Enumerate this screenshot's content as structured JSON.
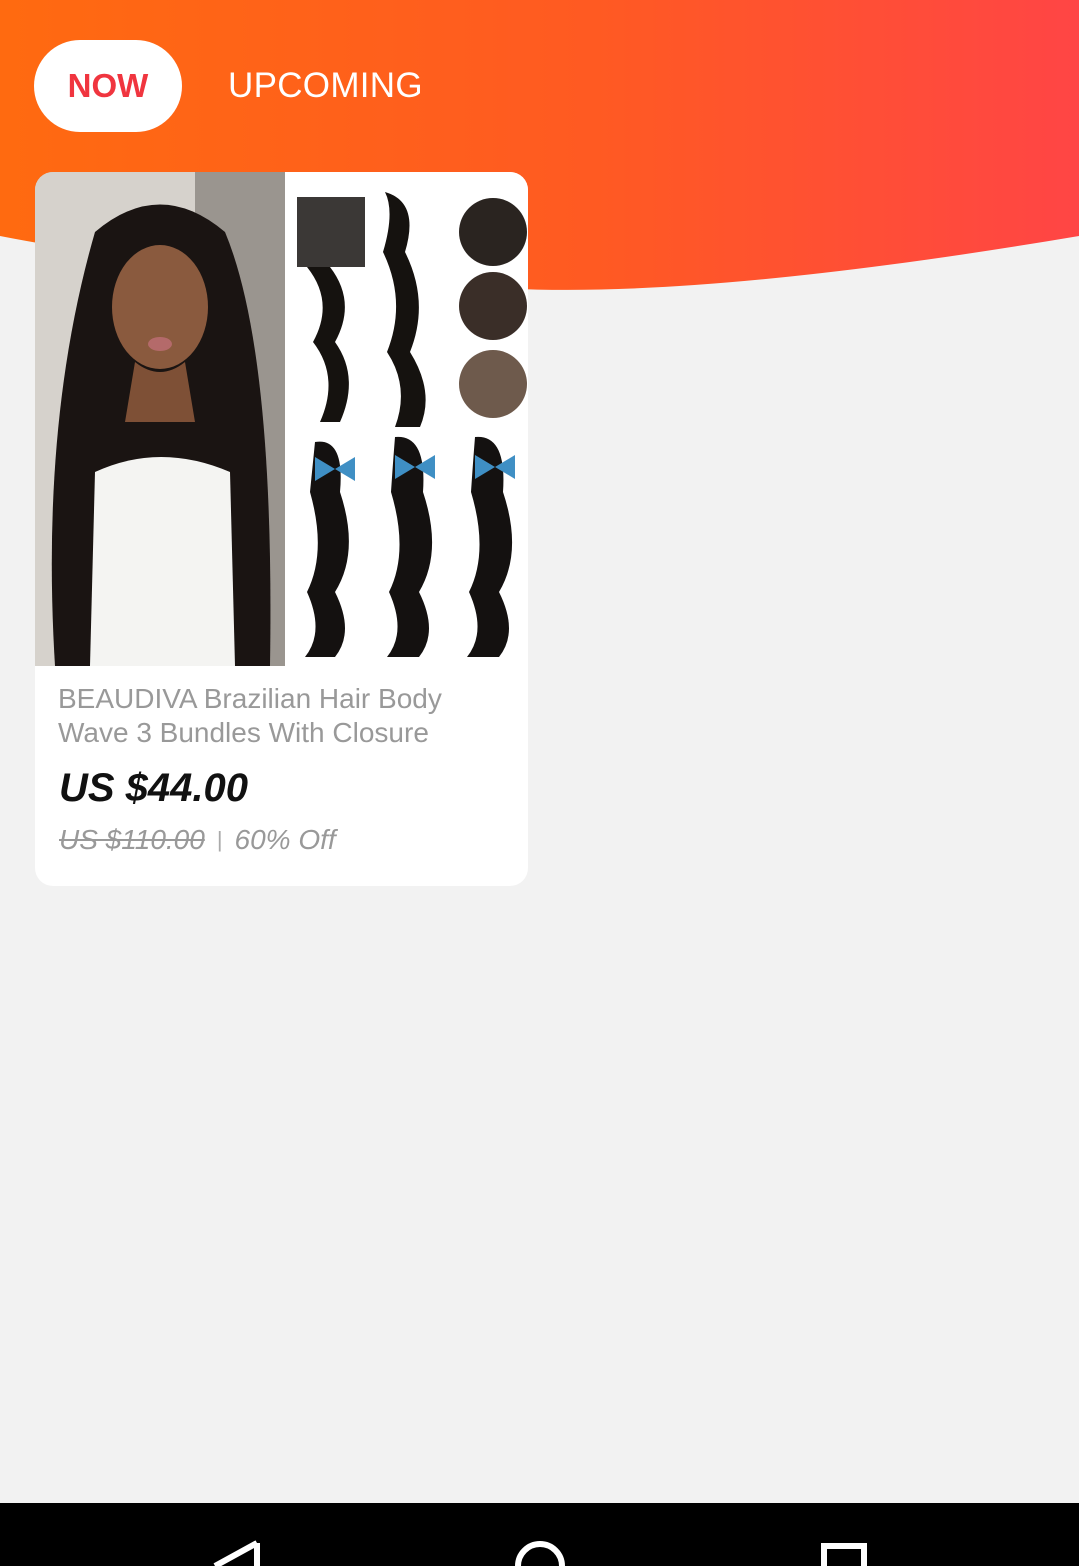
{
  "tabs": {
    "now_label": "NOW",
    "upcoming_label": "UPCOMING"
  },
  "product": {
    "image": "hair-bundles-product-photo",
    "title": "BEAUDIVA Brazilian Hair Body Wave 3 Bundles With Closure",
    "price": "US $44.00",
    "original_price": "US $110.00",
    "separator": "|",
    "discount": "60% Off"
  },
  "navbar": {
    "back_icon": "back-triangle-icon",
    "home_icon": "home-circle-icon",
    "recents_icon": "recents-square-icon"
  },
  "colors": {
    "header_gradient_start": "#ff6a10",
    "header_gradient_end": "#ff4444",
    "accent_red": "#f0353f",
    "background": "#f2f2f2"
  }
}
